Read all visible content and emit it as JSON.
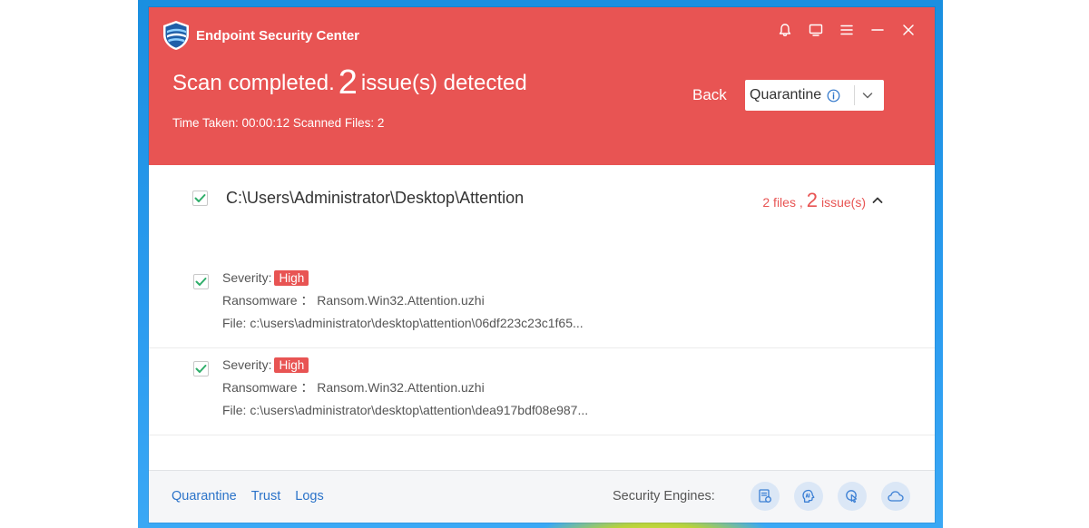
{
  "app": {
    "title": "Endpoint Security Center"
  },
  "header": {
    "scan_prefix": "Scan completed.",
    "issue_count": "2",
    "scan_suffix": "issue(s) detected",
    "meta": "Time Taken: 00:00:12  Scanned Files: 2",
    "back_label": "Back",
    "action_label": "Quarantine"
  },
  "folder": {
    "path": "C:\\Users\\Administrator\\Desktop\\Attention",
    "files_text": "2 files ,",
    "issue_count": "2",
    "issues_text": "issue(s)"
  },
  "issues": [
    {
      "severity_label": "Severity:",
      "severity": "High",
      "threat": "Ransomware ： Ransom.Win32.Attention.uzhi",
      "file": "File: c:\\users\\administrator\\desktop\\attention\\06df223c23c1f65..."
    },
    {
      "severity_label": "Severity:",
      "severity": "High",
      "threat": "Ransomware ： Ransom.Win32.Attention.uzhi",
      "file": "File: c:\\users\\administrator\\desktop\\attention\\dea917bdf08e987..."
    }
  ],
  "footer": {
    "links": [
      "Quarantine",
      "Trust",
      "Logs"
    ],
    "engines_label": "Security Engines:"
  },
  "icons": {
    "window_controls": [
      "bell-icon",
      "monitor-icon",
      "menu-icon",
      "minimize-icon",
      "close-icon"
    ],
    "engines": [
      "file-scan-engine-icon",
      "ai-engine-icon",
      "behavior-engine-icon",
      "cloud-engine-icon"
    ]
  },
  "colors": {
    "accent_red": "#e85453",
    "check_green": "#2fae6a",
    "link_blue": "#2b73c9",
    "engine_blue": "#3b7fd4"
  }
}
